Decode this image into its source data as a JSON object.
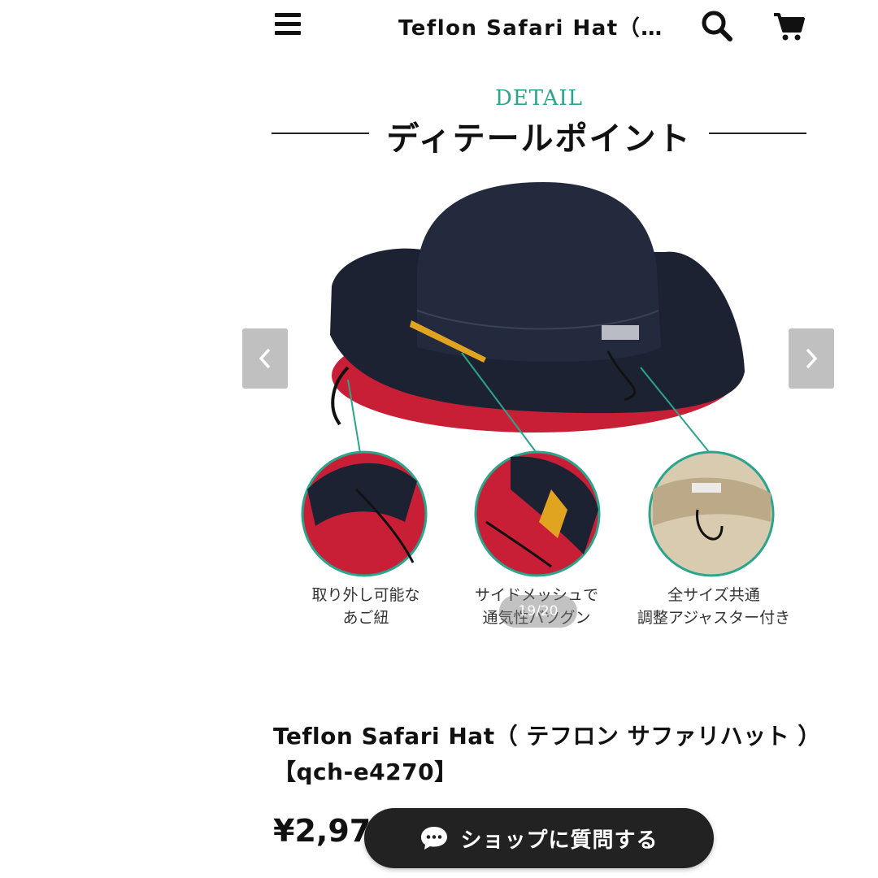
{
  "header": {
    "title": "Teflon Safari Hat（テ…",
    "menu_icon": "hamburger-menu-icon",
    "search_icon": "search-icon",
    "cart_icon": "cart-icon"
  },
  "carousel": {
    "detail_heading": "DETAIL",
    "detail_title": "ディテールポイント",
    "callouts": [
      {
        "line1": "取り外し可能な",
        "line2": "あご紐"
      },
      {
        "line1": "サイドメッシュで",
        "line2": "通気性バツグン"
      },
      {
        "line1": "全サイズ共通",
        "line2": "調整アジャスター付き"
      }
    ],
    "counter": "19/20",
    "prev_icon": "chevron-left-icon",
    "next_icon": "chevron-right-icon"
  },
  "product": {
    "title_line1": "Teflon Safari Hat（ テフロン サファリハット ）",
    "title_line2": "【qch-e4270】",
    "price": "¥2,97"
  },
  "chat_button": {
    "label": "ショップに質問する",
    "icon": "chat-bubble-icon"
  },
  "colors": {
    "accent_teal": "#2aa58c",
    "hat_navy": "#1d2233",
    "hat_lining_red": "#d2263c",
    "button_dark": "#222222"
  }
}
